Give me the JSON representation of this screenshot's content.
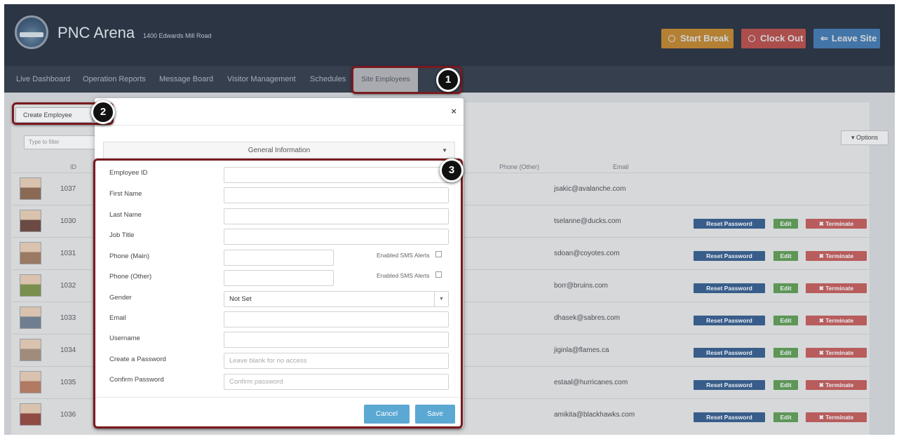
{
  "header": {
    "site_name": "PNC Arena",
    "site_address": "1400 Edwards Mill Road",
    "buttons": {
      "start_break": "Start Break",
      "clock_out": "Clock Out",
      "leave_site": "Leave Site"
    },
    "colors": {
      "start_break": "#d99630",
      "clock_out": "#d0564f",
      "leave_site": "#4a87c5"
    }
  },
  "nav": {
    "items": [
      "Live Dashboard",
      "Operation Reports",
      "Message Board",
      "Visitor Management",
      "Schedules",
      "Site Employees"
    ],
    "active": "Site Employees"
  },
  "toolbar": {
    "create_employee": "Create Employee",
    "filter_placeholder": "Type to filter",
    "options": "▾ Options"
  },
  "table": {
    "headers": {
      "id": "ID",
      "phone_other": "Phone (Other)",
      "email": "Email"
    },
    "rows": [
      {
        "id": "1037",
        "email": "jsakic@avalanche.com",
        "actions": false
      },
      {
        "id": "1030",
        "email": "tselanne@ducks.com",
        "actions": true
      },
      {
        "id": "1031",
        "email": "sdoan@coyotes.com",
        "actions": true
      },
      {
        "id": "1032",
        "email": "borr@bruins.com",
        "actions": true
      },
      {
        "id": "1033",
        "email": "dhasek@sabres.com",
        "actions": true
      },
      {
        "id": "1034",
        "email": "jiginla@flames.ca",
        "actions": true
      },
      {
        "id": "1035",
        "email": "estaal@hurricanes.com",
        "actions": true
      },
      {
        "id": "1036",
        "email": "amikita@blackhawks.com",
        "actions": true
      }
    ],
    "action_labels": {
      "reset_password": "Reset Password",
      "edit": "Edit",
      "terminate": "✖ Terminate"
    }
  },
  "modal": {
    "close": "×",
    "section_title": "General Information",
    "fields": {
      "employee_id": {
        "label": "Employee ID",
        "value": ""
      },
      "first_name": {
        "label": "First Name",
        "value": ""
      },
      "last_name": {
        "label": "Last Name",
        "value": ""
      },
      "job_title": {
        "label": "Job Title",
        "value": ""
      },
      "phone_main": {
        "label": "Phone (Main)",
        "value": ""
      },
      "phone_other": {
        "label": "Phone (Other)",
        "value": ""
      },
      "gender": {
        "label": "Gender",
        "value": "Not Set"
      },
      "email": {
        "label": "Email",
        "value": ""
      },
      "username": {
        "label": "Username",
        "value": ""
      },
      "password": {
        "label": "Create a Password",
        "placeholder": "Leave blank for no access"
      },
      "confirm_password": {
        "label": "Confirm Password",
        "placeholder": "Confirm password"
      }
    },
    "sms_label": "Enabled SMS Alerts",
    "cancel": "Cancel",
    "save": "Save"
  },
  "callouts": [
    "1",
    "2",
    "3"
  ]
}
